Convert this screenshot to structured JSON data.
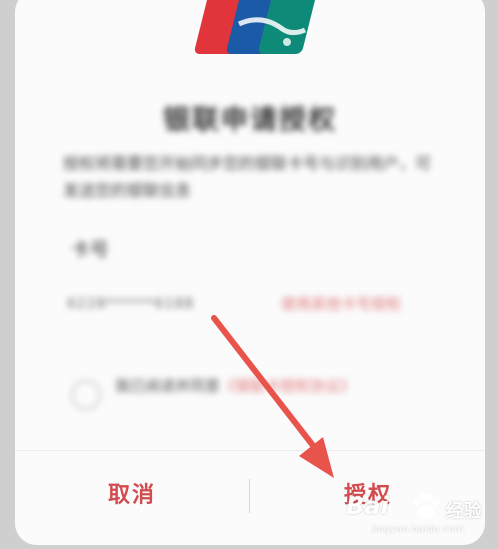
{
  "dialog": {
    "title": "银联申请授权",
    "description": "授权将需要您开始同步您的银联卡号与识别用户，可发送您的银联信息",
    "card_label": "卡号",
    "card_number": "6228******6188",
    "other_card_link": "使用其他卡号授权",
    "agreement_prefix": "我已阅读并同意",
    "agreement_link": "《银联卡授权协议》"
  },
  "buttons": {
    "cancel_label": "取消",
    "authorize_label": "授权"
  },
  "watermark": {
    "brand": "Bai",
    "brand_suffix": "经验",
    "url": "jingyan.baidu.com"
  },
  "colors": {
    "accent": "#d24c4f",
    "arrow": "#e8544b",
    "unionpay_red": "#e2353b",
    "unionpay_blue": "#1b5aa6",
    "unionpay_green": "#0e8a78"
  },
  "icons": {
    "logo": "unionpay-logo",
    "arrow": "down-right-arrow",
    "checkbox": "radio-circle"
  }
}
